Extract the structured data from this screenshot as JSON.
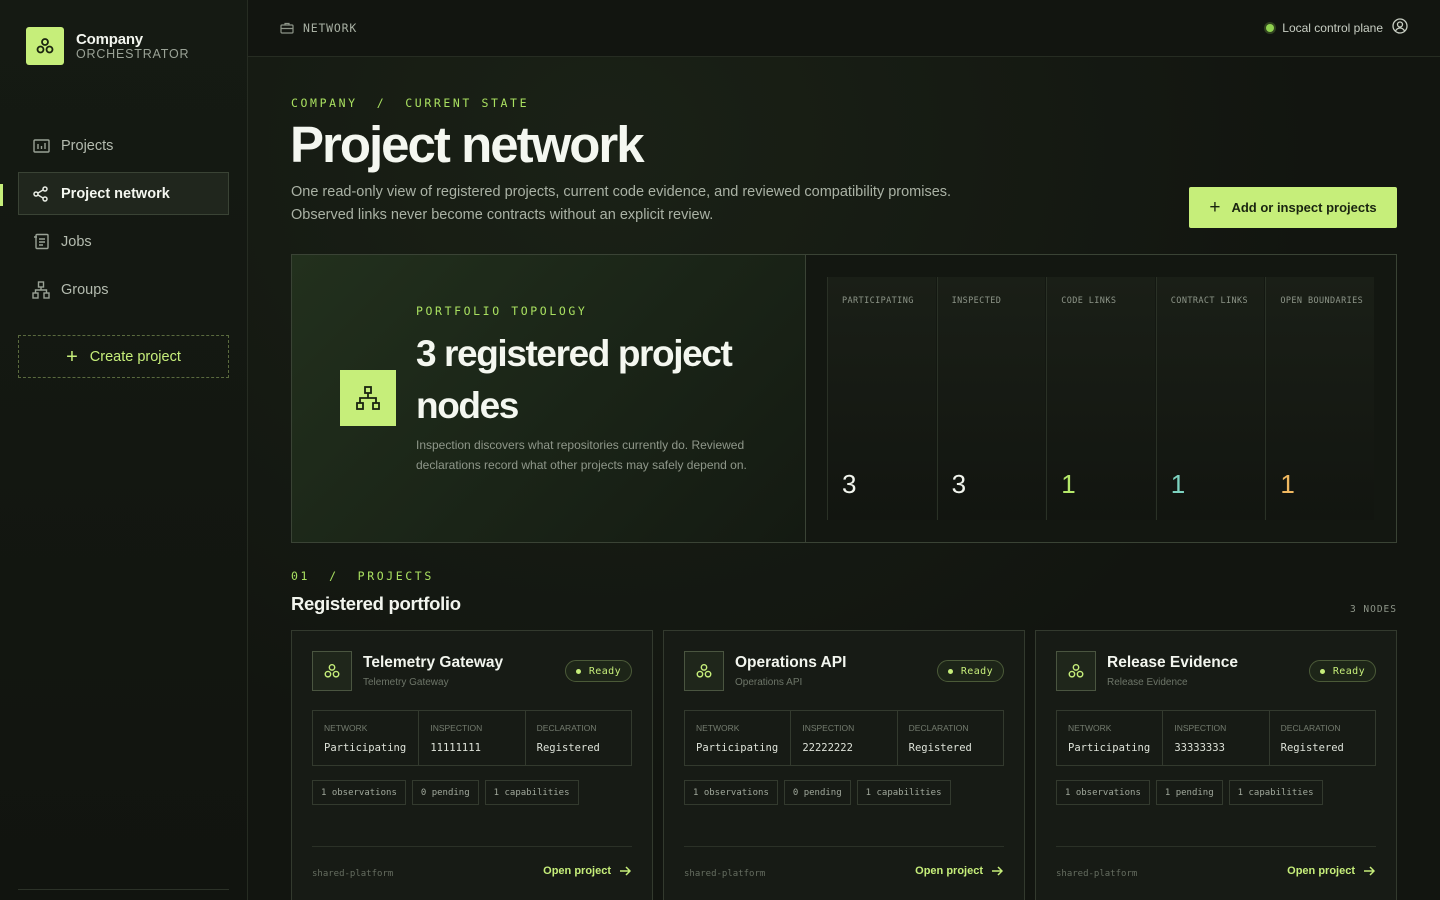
{
  "brand": {
    "name": "Company",
    "subtitle": "ORCHESTRATOR"
  },
  "sidebar": {
    "items": [
      {
        "label": "Projects",
        "icon": "folder-icon"
      },
      {
        "label": "Project network",
        "icon": "network-icon",
        "active": true
      },
      {
        "label": "Jobs",
        "icon": "jobs-icon"
      },
      {
        "label": "Groups",
        "icon": "groups-icon"
      }
    ],
    "create_label": "Create project"
  },
  "topbar": {
    "breadcrumb": "NETWORK",
    "status_label": "Local control plane"
  },
  "header": {
    "eyebrow": "COMPANY  /  CURRENT STATE",
    "title": "Project network",
    "description_line1": "One read-only view of registered projects, current code evidence, and reviewed compatibility promises.",
    "description_line2": "Observed links never become contracts without an explicit review.",
    "primary_action": "Add or inspect projects"
  },
  "topology": {
    "eyebrow": "PORTFOLIO TOPOLOGY",
    "title": "3 registered project nodes",
    "description": "Inspection discovers what repositories currently do. Reviewed declarations record what other projects may safely depend on.",
    "stats": [
      {
        "label": "PARTICIPATING",
        "value": "3",
        "color": "#f2f5ee"
      },
      {
        "label": "INSPECTED",
        "value": "3",
        "color": "#f2f5ee"
      },
      {
        "label": "CODE LINKS",
        "value": "1",
        "color": "#b5e86a"
      },
      {
        "label": "CONTRACT LINKS",
        "value": "1",
        "color": "#7dd3c0"
      },
      {
        "label": "OPEN BOUNDARIES",
        "value": "1",
        "color": "#f0b860"
      }
    ]
  },
  "projects": {
    "eyebrow": "01  /  PROJECTS",
    "title": "Registered portfolio",
    "count": "3 NODES",
    "fact_labels": [
      "NETWORK",
      "INSPECTION",
      "DECLARATION"
    ],
    "cards": [
      {
        "name": "Telemetry Gateway",
        "subtitle": "Telemetry Gateway",
        "status": "Ready",
        "network": "Participating",
        "inspection": "11111111",
        "declaration": "Registered",
        "chips": [
          "1 observations",
          "0 pending",
          "1 capabilities"
        ],
        "group": "shared-platform",
        "link": "Open project"
      },
      {
        "name": "Operations API",
        "subtitle": "Operations API",
        "status": "Ready",
        "network": "Participating",
        "inspection": "22222222",
        "declaration": "Registered",
        "chips": [
          "1 observations",
          "0 pending",
          "1 capabilities"
        ],
        "group": "shared-platform",
        "link": "Open project"
      },
      {
        "name": "Release Evidence",
        "subtitle": "Release Evidence",
        "status": "Ready",
        "network": "Participating",
        "inspection": "33333333",
        "declaration": "Registered",
        "chips": [
          "1 observations",
          "1 pending",
          "1 capabilities"
        ],
        "group": "shared-platform",
        "link": "Open project"
      }
    ]
  },
  "colors": {
    "accent": "#c6ee7a",
    "background": "#121510",
    "border": "#3a4335"
  }
}
